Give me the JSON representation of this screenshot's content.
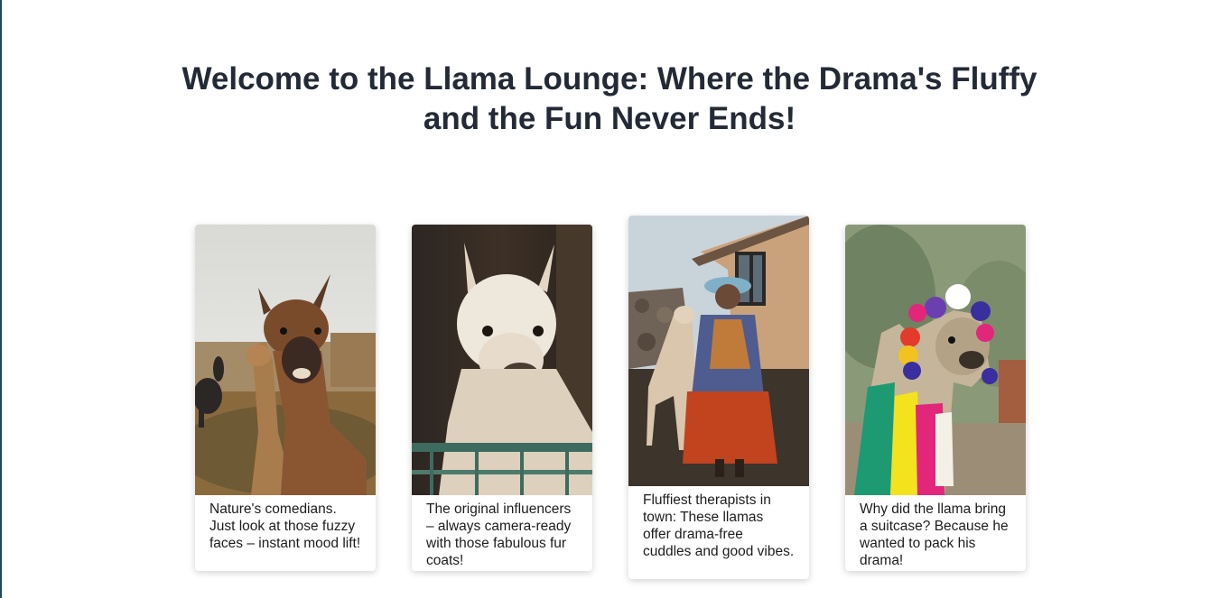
{
  "page": {
    "title_line1": "Welcome to the Llama Lounge: Where the Drama's Fluffy",
    "title_line2": "and the Fun Never Ends!"
  },
  "cards": [
    {
      "photo": "llama-comedians-photo",
      "caption": "Nature's comedians. Just look at those fuzzy faces – instant mood lift!"
    },
    {
      "photo": "alpaca-influencer-photo",
      "caption": "The original influencers – always camera-ready with those fabulous fur coats!"
    },
    {
      "photo": "llama-therapist-photo",
      "caption": "Fluffiest therapists in town: These llamas offer drama-free cuddles and good vibes."
    },
    {
      "photo": "llama-pompoms-photo",
      "caption": "Why did the llama bring a suitcase? Because he wanted to pack his drama!"
    }
  ],
  "colors": {
    "title": "#232a36",
    "caption": "#1d1d1d",
    "edge": "#1f4a57"
  }
}
